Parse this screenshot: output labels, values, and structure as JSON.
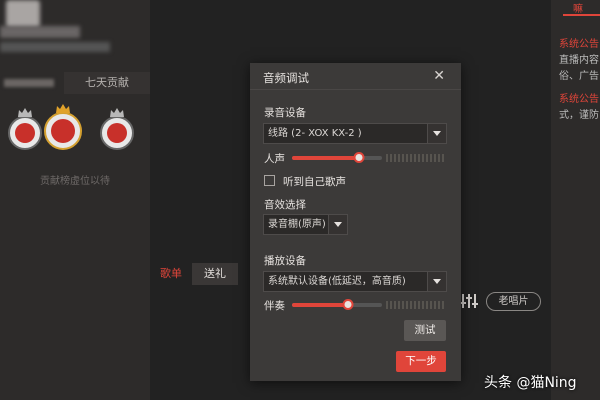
{
  "left_panel": {
    "tab_7day": "七天贡献",
    "rank_empty": "贡献榜虚位以待",
    "tab_song": "歌单",
    "tab_gift": "送礼"
  },
  "right_panel": {
    "tab": "嘛",
    "line1": "系统公告",
    "line2": "直播内容",
    "line3": "俗、广告",
    "line4": "系统公告",
    "line5": "式，谨防"
  },
  "controls": {
    "singer_button": "老唱片"
  },
  "dialog": {
    "title": "音频调试",
    "recording_device_label": "录音设备",
    "recording_device_value": "线路 (2- XOX KX-2 )",
    "voice_label": "人声",
    "voice_level": 0.74,
    "monitor_checkbox_label": "听到自己歌声",
    "monitor_checked": false,
    "effect_label": "音效选择",
    "effect_value": "录音棚(原声)",
    "playback_device_label": "播放设备",
    "playback_device_value": "系统默认设备(低延迟，高音质)",
    "accompaniment_label": "伴奏",
    "accompaniment_level": 0.62,
    "test_button": "测试",
    "next_button": "下一步"
  },
  "watermark": "头条 @猫Ning",
  "colors": {
    "accent": "#e0453a",
    "dialog_bg": "#3c3a39",
    "panel_bg": "#2d2b2a"
  }
}
